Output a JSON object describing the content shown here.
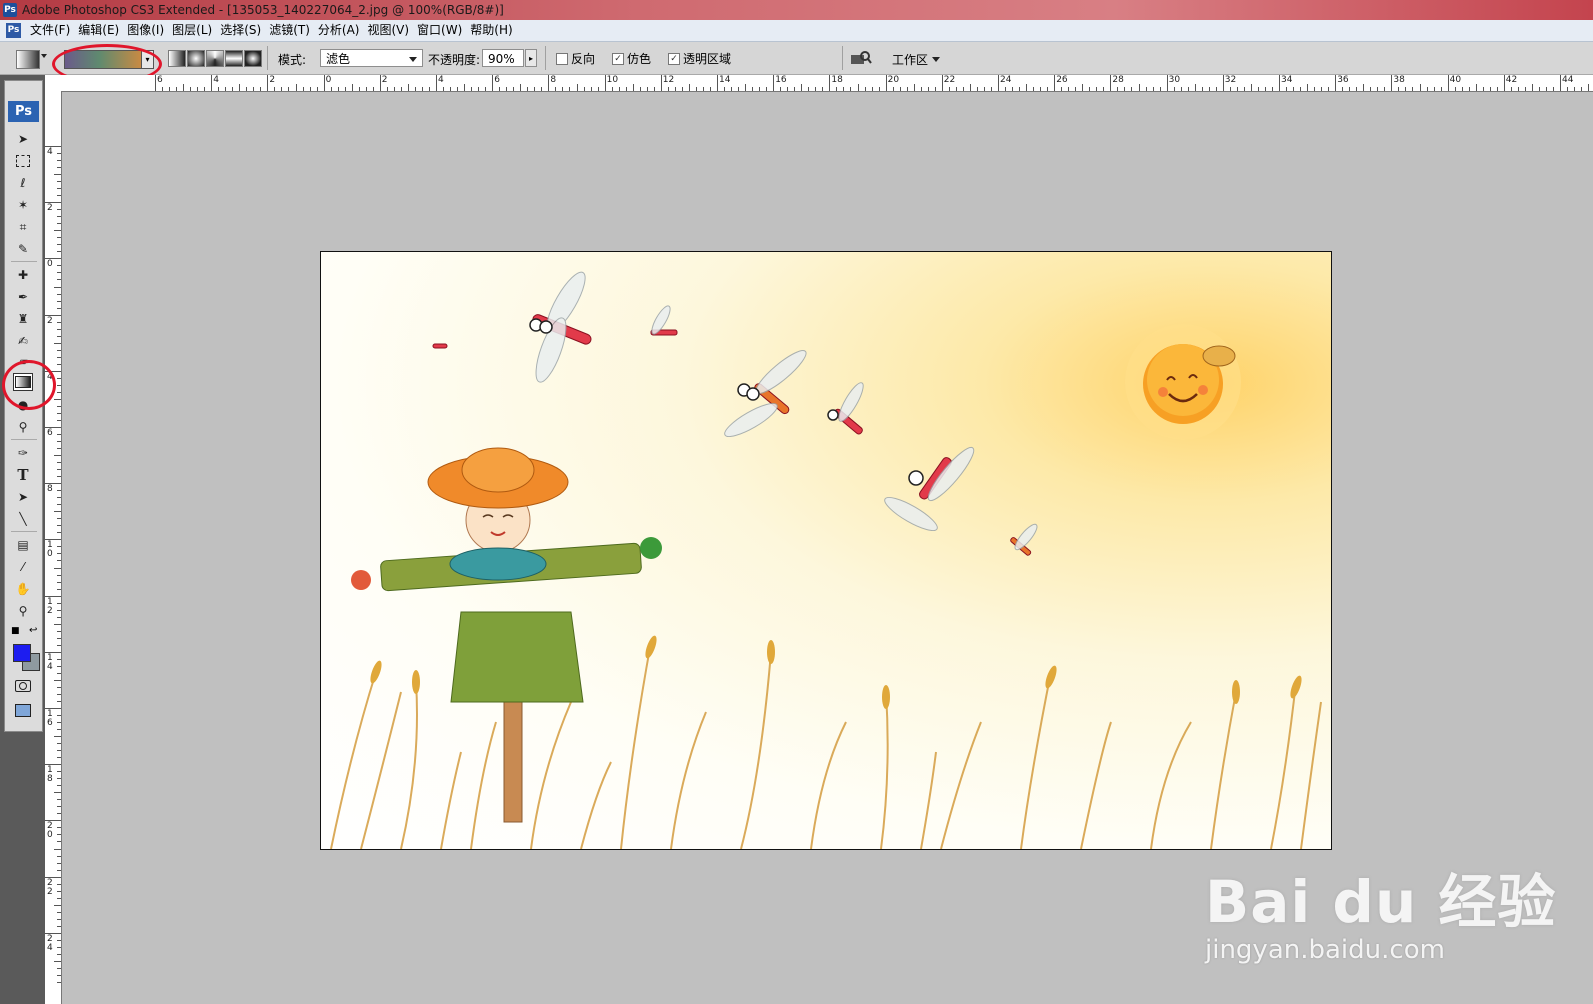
{
  "window": {
    "title": "Adobe Photoshop CS3 Extended - [135053_140227064_2.jpg @ 100%(RGB/8#)]",
    "app_icon": "Ps"
  },
  "menu": [
    "文件(F)",
    "编辑(E)",
    "图像(I)",
    "图层(L)",
    "选择(S)",
    "滤镜(T)",
    "分析(A)",
    "视图(V)",
    "窗口(W)",
    "帮助(H)"
  ],
  "options": {
    "mode_label": "模式:",
    "mode_value": "滤色",
    "opacity_label": "不透明度:",
    "opacity_value": "90%",
    "reverse_label": "反向",
    "dither_label": "仿色",
    "transparency_label": "透明区域",
    "workspace_label": "工作区"
  },
  "toolbox": {
    "logo": "Ps",
    "foreground_color": "#1d1df0",
    "background_color": "#8e9aa0",
    "active_tool": "gradient-tool"
  },
  "ruler": {
    "top_labels": [
      "6",
      "4",
      "2",
      "0",
      "2",
      "4",
      "6",
      "8",
      "10",
      "12",
      "14",
      "16",
      "18",
      "20",
      "22",
      "24",
      "26",
      "28",
      "30",
      "32",
      "34",
      "36",
      "38",
      "40",
      "42",
      "44"
    ],
    "left_labels": [
      "4",
      "2",
      "0",
      "2",
      "4",
      "6",
      "8",
      "10",
      "12",
      "14",
      "16",
      "18",
      "20",
      "22",
      "24"
    ]
  },
  "watermark": {
    "line1": "Bai du 经验",
    "line2": "jingyan.baidu.com"
  },
  "accent_colors": {
    "annotation": "#e0162b",
    "ps_blue": "#2b63b2"
  }
}
